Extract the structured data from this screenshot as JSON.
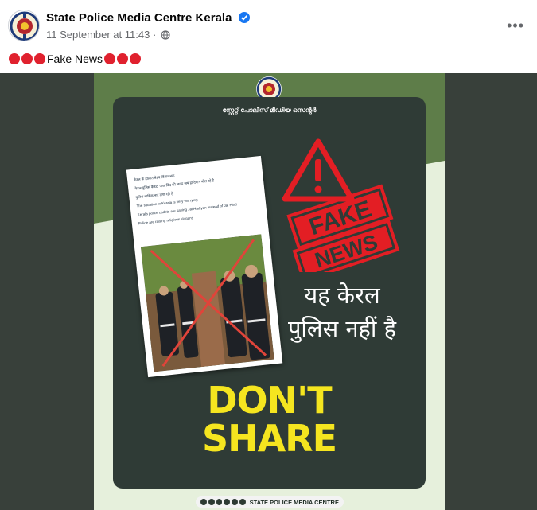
{
  "page": {
    "name": "State Police Media Centre Kerala",
    "timestamp": "11 September at 11:43",
    "separator": "·"
  },
  "icons": {
    "avatar": "kerala-police-emblem",
    "verified": "verified-badge-icon",
    "privacy": "globe-icon",
    "more": "more-options-icon"
  },
  "post": {
    "caption_text": "Fake News",
    "caption_dots_before": 3,
    "caption_dots_after": 3
  },
  "poster": {
    "malayalam_title": "സ്റ്റേറ്റ് പോലീസ് മീഡിയ സെന്റർ",
    "fake_news_badge_lines": [
      "FAKE",
      "NEWS"
    ],
    "hindi_line1": "यह केरल",
    "hindi_line2": "पुलिस नहीं है",
    "dont_share_line1": "DON'T",
    "dont_share_line2": "SHARE",
    "footer_label": "STATE POLICE MEDIA CENTRE",
    "clip_lines": [
      "केरल के हालात बेहद चिंताजनक",
      "केरल पुलिस कैडेट, पाक बिंद की जगह जय हादियान बोल रहे है",
      "पुलिस धार्मिक नारे लगा रही है",
      "The situation in Kerala is very worrying",
      "Kerala police cadets are saying Jai Hadiyan instead of Jai Hind",
      "Police are raising religious slogans"
    ]
  },
  "colors": {
    "fake_red": "#e31e24",
    "dont_share_yellow": "#f5e51f",
    "poster_dark": "#2f3b36",
    "poster_green": "#5e7d49"
  }
}
